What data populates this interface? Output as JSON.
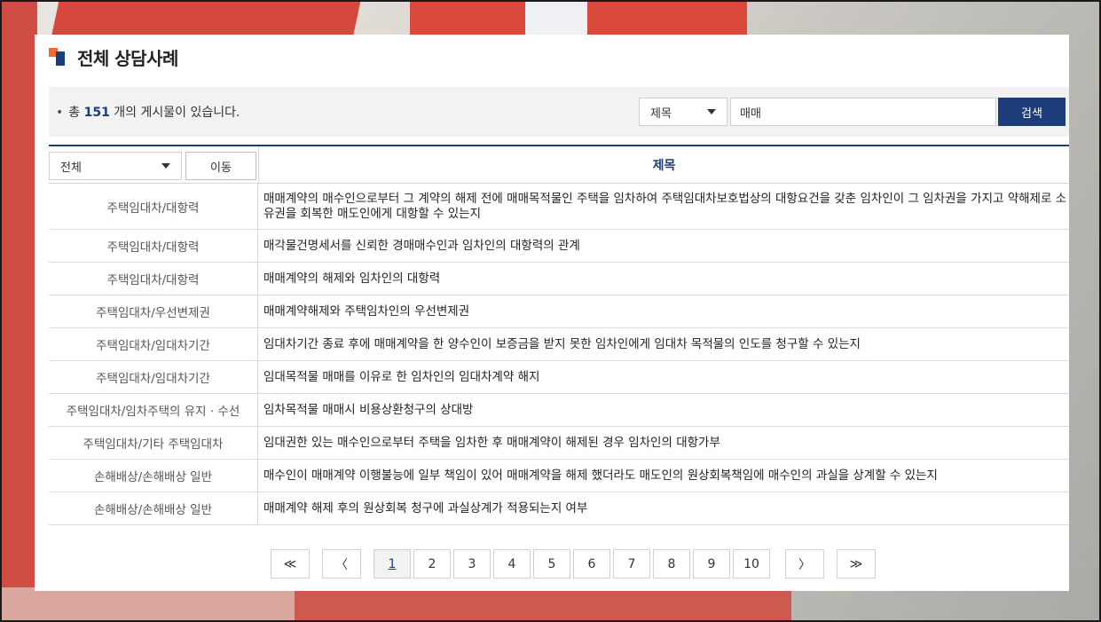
{
  "page": {
    "title": "전체 상담사례"
  },
  "summary": {
    "prefix": "총",
    "count": "151",
    "suffix": "개의 게시물이 있습니다."
  },
  "search": {
    "field_select": "제목",
    "query": "매매",
    "button": "검색"
  },
  "filter": {
    "category_select": "전체",
    "move_button": "이동",
    "column_header": "제목"
  },
  "rows": [
    {
      "category": "주택임대차/대항력",
      "title": "매매계약의 매수인으로부터 그 계약의 해제 전에 매매목적물인 주택을 임차하여 주택임대차보호법상의 대항요건을 갖춘 임차인이 그 임차권을 가지고 약해제로 소유권을 회복한 매도인에게 대항할 수 있는지"
    },
    {
      "category": "주택임대차/대항력",
      "title": "매각물건명세서를 신뢰한 경매매수인과 임차인의 대항력의 관계"
    },
    {
      "category": "주택임대차/대항력",
      "title": "매매계약의 해제와 임차인의 대항력"
    },
    {
      "category": "주택임대차/우선변제권",
      "title": "매매계약해제와 주택임차인의 우선변제권"
    },
    {
      "category": "주택임대차/임대차기간",
      "title": "임대차기간 종료 후에 매매계약을 한 양수인이 보증금을 받지 못한 임차인에게 임대차 목적물의 인도를 청구할 수 있는지"
    },
    {
      "category": "주택임대차/임대차기간",
      "title": "임대목적물 매매를 이유로 한 임차인의 임대차계약 해지"
    },
    {
      "category": "주택임대차/임차주택의 유지 · 수선",
      "title": "임차목적물 매매시 비용상환청구의 상대방"
    },
    {
      "category": "주택임대차/기타 주택임대차",
      "title": "임대권한 있는 매수인으로부터 주택을 임차한 후 매매계약이 해제된 경우 임차인의 대항가부"
    },
    {
      "category": "손해배상/손해배상 일반",
      "title": "매수인이 매매계약 이행불능에 일부 책임이 있어 매매계약을 해제 했더라도 매도인의 원상회복책임에 매수인의 과실을 상계할 수 있는지"
    },
    {
      "category": "손해배상/손해배상 일반",
      "title": "매매계약 해제 후의 원상회복 청구에 과실상계가 적용되는지 여부"
    }
  ],
  "pagination": {
    "first": "≪",
    "prev": "〈",
    "pages": [
      "1",
      "2",
      "3",
      "4",
      "5",
      "6",
      "7",
      "8",
      "9",
      "10"
    ],
    "current": "1",
    "next": "〉",
    "last": "≫"
  },
  "colors": {
    "accent": "#1d3d7a",
    "orange": "#ee6b2f"
  }
}
